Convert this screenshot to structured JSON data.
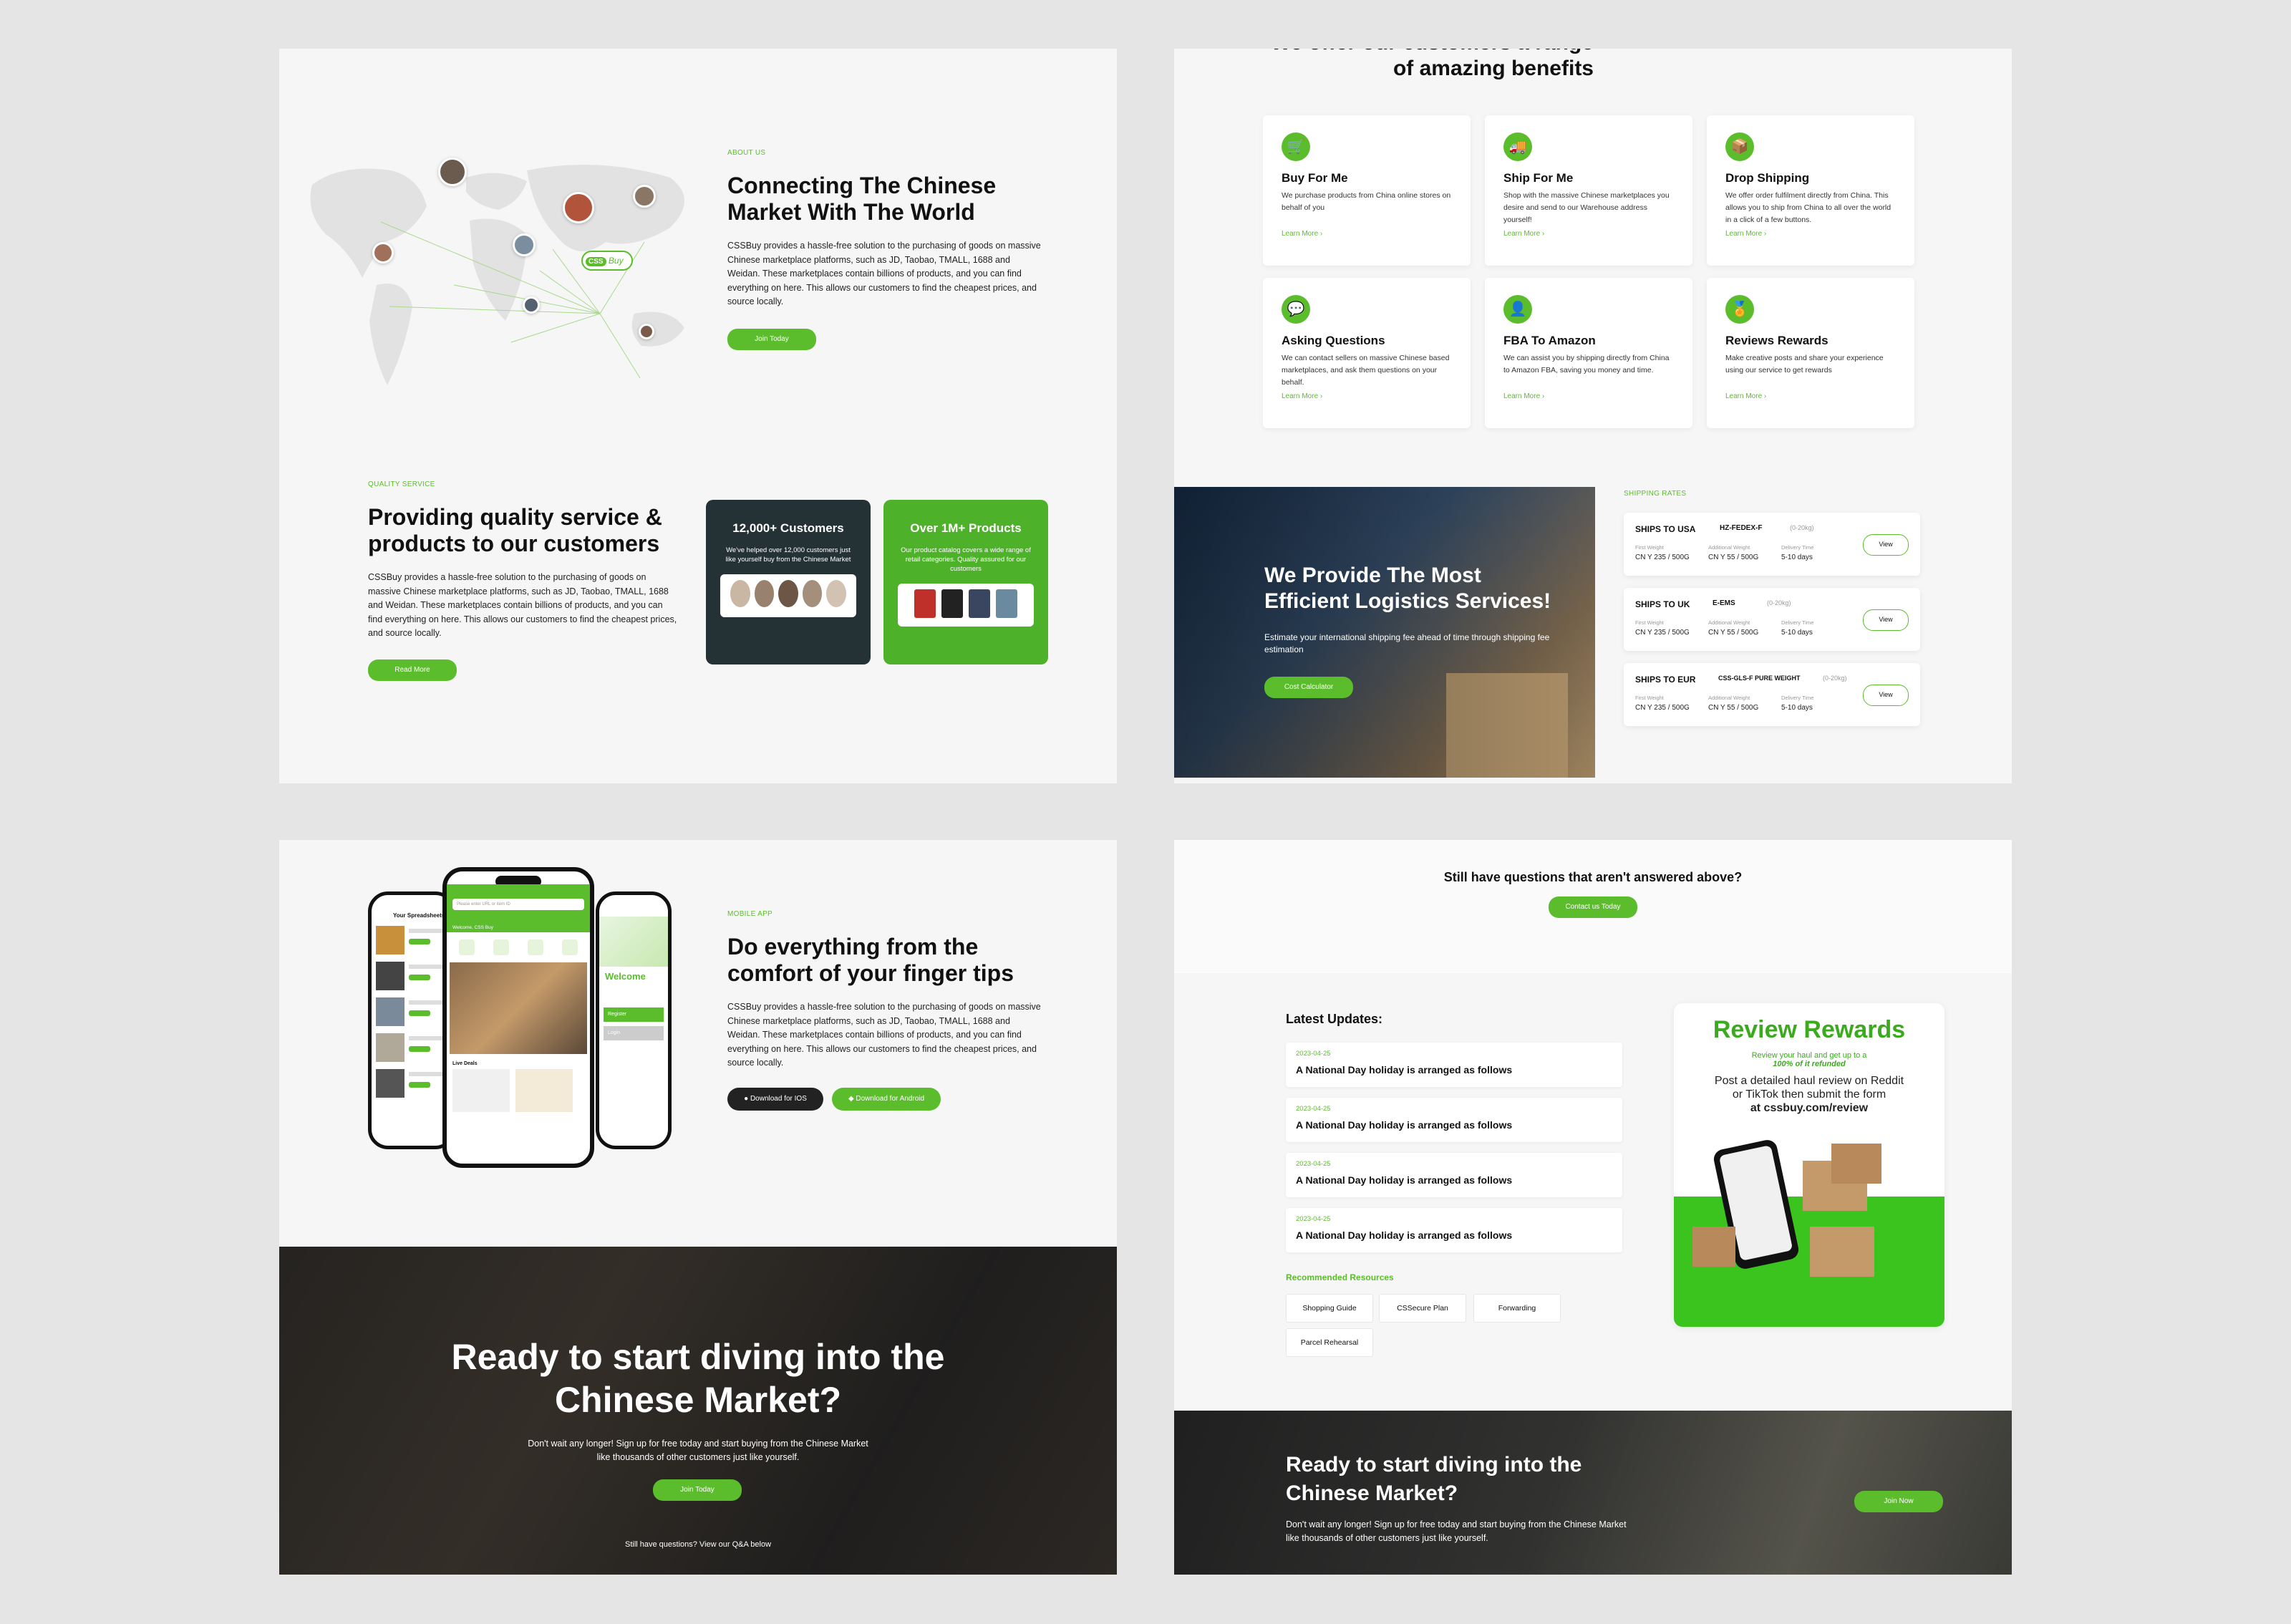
{
  "p1": {
    "about": {
      "eyebrow": "ABOUT US",
      "title_line1": "Connecting The Chinese",
      "title_line2": "Market With The World",
      "body": "CSSBuy provides a hassle-free solution to the purchasing of goods on massive Chinese marketplace platforms, such as JD, Taobao, TMALL, 1688 and Weidan. These marketplaces contain billions of products, and you can find everything on here. This allows our customers to find the cheapest prices, and source locally.",
      "button": "Join Today",
      "map_badge_left": "CSS",
      "map_badge_right": "Buy"
    },
    "quality": {
      "eyebrow": "QUALITY SERVICE",
      "title_line1": "Providing quality service &",
      "title_line2": "products to our customers",
      "body": "CSSBuy provides a hassle-free solution to the purchasing of goods on massive Chinese marketplace platforms, such as JD, Taobao, TMALL, 1688 and Weidan. These marketplaces contain billions of products, and you can find everything on here. This allows our customers to find the cheapest prices, and source locally.",
      "button": "Read More",
      "stat1_title": "12,000+ Customers",
      "stat1_body": "We've helped over 12,000 customers just like yourself buy from the Chinese Market",
      "stat2_title": "Over 1M+ Products",
      "stat2_body": "Our product catalog covers a wide range of retail categories. Quality assured for our customers"
    }
  },
  "p2": {
    "heading_line1": "We offer our customers a range",
    "heading_line2": "of amazing benefits",
    "cards": [
      {
        "icon": "cart-icon",
        "title": "Buy For Me",
        "desc": "We purchase products from China online stores on behalf of you",
        "link": "Learn More ›"
      },
      {
        "icon": "truck-icon",
        "title": "Ship For Me",
        "desc": "Shop with the massive Chinese marketplaces you desire and send to our Warehouse address yourself!",
        "link": "Learn More ›"
      },
      {
        "icon": "box-icon",
        "title": "Drop Shipping",
        "desc": "We offer order fulfilment directly from China. This allows you to ship from China to all over the world in a click of a few buttons.",
        "link": "Learn More ›"
      },
      {
        "icon": "chat-icon",
        "title": "Asking Questions",
        "desc": "We can contact sellers on massive Chinese based marketplaces, and ask them questions on your behalf.",
        "link": "Learn More ›"
      },
      {
        "icon": "user-icon",
        "title": "FBA To Amazon",
        "desc": "We can assist you by shipping directly from China to Amazon FBA, saving you money and time.",
        "link": "Learn More ›"
      },
      {
        "icon": "medal-icon",
        "title": "Reviews Rewards",
        "desc": "Make creative posts and share your experience using our service to get rewards",
        "link": "Learn More ›"
      }
    ],
    "logistics": {
      "title_line1": "We Provide The Most",
      "title_line2": "Efficient Logistics Services!",
      "body": "Estimate your international shipping fee ahead of time through shipping fee estimation",
      "button": "Cost Calculator"
    },
    "rates_eyebrow": "SHIPPING RATES",
    "rates": [
      {
        "dest": "SHIPS TO USA",
        "carrier": "HZ-FEDEX-F",
        "weight": "(0-20kg)",
        "first_label": "First Weight",
        "first": "CN Y 235 / 500G",
        "add_label": "Additional Weight",
        "add": "CN Y 55 / 500G",
        "time_label": "Delivery Time",
        "time": "5-10 days",
        "button": "View"
      },
      {
        "dest": "SHIPS TO UK",
        "carrier": "E-EMS",
        "weight": "(0-20kg)",
        "first_label": "First Weight",
        "first": "CN Y 235 / 500G",
        "add_label": "Additional Weight",
        "add": "CN Y 55 / 500G",
        "time_label": "Delivery Time",
        "time": "5-10 days",
        "button": "View"
      },
      {
        "dest": "SHIPS TO EUR",
        "carrier": "CSS-GLS-F PURE WEIGHT",
        "weight": "(0-20kg)",
        "first_label": "First Weight",
        "first": "CN Y 235 / 500G",
        "add_label": "Additional Weight",
        "add": "CN Y 55 / 500G",
        "time_label": "Delivery Time",
        "time": "5-10 days",
        "button": "View"
      }
    ]
  },
  "p3": {
    "eyebrow": "MOBILE APP",
    "title_line1": "Do everything from the",
    "title_line2": "comfort of your finger tips",
    "body": "CSSBuy provides a hassle-free solution to the purchasing of goods on massive Chinese marketplace platforms, such as JD, Taobao, TMALL, 1688 and Weidan. These marketplaces contain billions of products, and you can find everything on here. This allows our customers to find the cheapest prices, and source locally.",
    "ios_button": "Download for IOS",
    "android_button": "Download for Android",
    "phone": {
      "search_placeholder": "Please enter URL or item ID",
      "welcome": "Welcome, CSS Buy",
      "spreadsheets": "Your Spreadsheets",
      "live_deals": "Live Deals",
      "welcome_big": "Welcome",
      "register": "Register",
      "login": "Login"
    },
    "cta": {
      "title_line1": "Ready to start diving into the",
      "title_line2": "Chinese Market?",
      "body_line1": "Don't wait any longer! Sign up for free today and start buying from the Chinese Market",
      "body_line2": "like thousands of other customers just like yourself.",
      "button": "Join Today",
      "footer": "Still have questions? View our Q&A below"
    }
  },
  "p4": {
    "question": "Still have questions that aren't answered above?",
    "contact_button": "Contact us Today",
    "updates_title": "Latest Updates:",
    "updates": [
      {
        "date": "2023-04-25",
        "title": "A National Day holiday is arranged as follows"
      },
      {
        "date": "2023-04-25",
        "title": "A National Day holiday is arranged as follows"
      },
      {
        "date": "2023-04-25",
        "title": "A National Day holiday is arranged as follows"
      },
      {
        "date": "2023-04-25",
        "title": "A National Day holiday is arranged as follows"
      }
    ],
    "resources_title": "Recommended Resources",
    "resources": [
      "Shopping Guide",
      "CSSecure Plan",
      "Forwarding",
      "Parcel Rehearsal"
    ],
    "promo": {
      "title": "Review Rewards",
      "sub1": "Review your haul and get up to a",
      "sub2": "100% of it refunded",
      "line1": "Post a detailed haul review on Reddit",
      "line2": "or TikTok then submit the form",
      "line3": "at cssbuy.com/review"
    },
    "cta": {
      "title_line1": "Ready to start diving into the",
      "title_line2": "Chinese Market?",
      "body_line1": "Don't wait any longer! Sign up for free today and start buying from the Chinese Market",
      "body_line2": "like thousands of other customers just like yourself.",
      "button": "Join Now"
    }
  },
  "colors": {
    "accent": "#5bbd2c",
    "dark_card": "#243236",
    "background": "#e5e5e5"
  }
}
